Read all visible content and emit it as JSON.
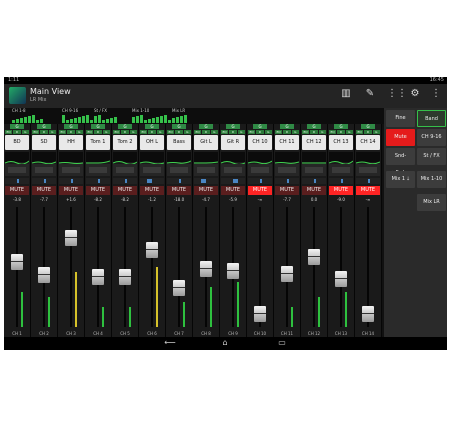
{
  "status": {
    "time_left": "1:11",
    "time_right": "16:45"
  },
  "app": {
    "title": "Main View",
    "subtitle": "LR Mix"
  },
  "action_icons": [
    "meters-icon",
    "pencil-icon",
    "grid-icon",
    "settings-icon",
    "overflow-menu-icon"
  ],
  "meter_groups": [
    {
      "label": "CH 1-8"
    },
    {
      "label": "CH 9-16"
    },
    {
      "label": "St / FX"
    },
    {
      "label": "Mix 1-10"
    },
    {
      "label": "Mix LR"
    }
  ],
  "strip_common": {
    "group_tag": "G",
    "eq_tags": [
      "EQ",
      "D",
      "G"
    ],
    "mute_label": "MUTE"
  },
  "channels": [
    {
      "name": "BD",
      "value": "-3.8",
      "mute": false,
      "ch": "CH 1",
      "level": 0.55,
      "meter": 0.35,
      "pan": 0.5
    },
    {
      "name": "SD",
      "value": "-7.7",
      "mute": false,
      "ch": "CH 2",
      "level": 0.42,
      "meter": 0.3,
      "pan": 0.5
    },
    {
      "name": "HH",
      "value": "+1.6",
      "mute": false,
      "ch": "CH 3",
      "level": 0.78,
      "meter": 0.55,
      "pan": 0.5
    },
    {
      "name": "Tom 1",
      "value": "-8.2",
      "mute": false,
      "ch": "CH 4",
      "level": 0.4,
      "meter": 0.2,
      "pan": 0.5
    },
    {
      "name": "Tom 2",
      "value": "-8.2",
      "mute": false,
      "ch": "CH 5",
      "level": 0.4,
      "meter": 0.2,
      "pan": 0.5
    },
    {
      "name": "OH L",
      "value": "-1.2",
      "mute": false,
      "ch": "CH 6",
      "level": 0.66,
      "meter": 0.6,
      "pan": 0.3
    },
    {
      "name": "Bass",
      "value": "-18.0",
      "mute": false,
      "ch": "CH 7",
      "level": 0.3,
      "meter": 0.25,
      "pan": 0.5
    },
    {
      "name": "Git L",
      "value": "-4.7",
      "mute": false,
      "ch": "CH 8",
      "level": 0.48,
      "meter": 0.4,
      "pan": 0.3
    },
    {
      "name": "Git R",
      "value": "-5.9",
      "mute": false,
      "ch": "CH 9",
      "level": 0.46,
      "meter": 0.45,
      "pan": 0.7
    },
    {
      "name": "CH 10",
      "value": "-∞",
      "mute": true,
      "ch": "CH 10",
      "level": 0.05,
      "meter": 0.0,
      "pan": 0.5
    },
    {
      "name": "CH 11",
      "value": "-7.7",
      "mute": false,
      "ch": "CH 11",
      "level": 0.43,
      "meter": 0.2,
      "pan": 0.5
    },
    {
      "name": "CH 12",
      "value": "0.0",
      "mute": false,
      "ch": "CH 12",
      "level": 0.6,
      "meter": 0.3,
      "pan": 0.5
    },
    {
      "name": "CH 13",
      "value": "-9.0",
      "mute": true,
      "ch": "CH 13",
      "level": 0.38,
      "meter": 0.35,
      "pan": 0.5
    },
    {
      "name": "CH 14",
      "value": "-∞",
      "mute": true,
      "ch": "CH 14",
      "level": 0.05,
      "meter": 0.0,
      "pan": 0.5
    }
  ],
  "side": {
    "fine": "Fine",
    "band": "Band",
    "mute_enable": "Mute Enable",
    "ch_9_16": "CH 9-16",
    "snd_fader": "Snd->Fader",
    "st_fx": "St / FX",
    "mix1": "Mix 1",
    "mix1_10": "Mix 1-10",
    "mix_lr": "Mix LR"
  },
  "nav": {
    "back": "⟵",
    "home": "⌂",
    "recent": "▭"
  },
  "colors": {
    "accent": "#35c04a",
    "mute_on": "#ff2424",
    "enable": "#e51b1b"
  }
}
